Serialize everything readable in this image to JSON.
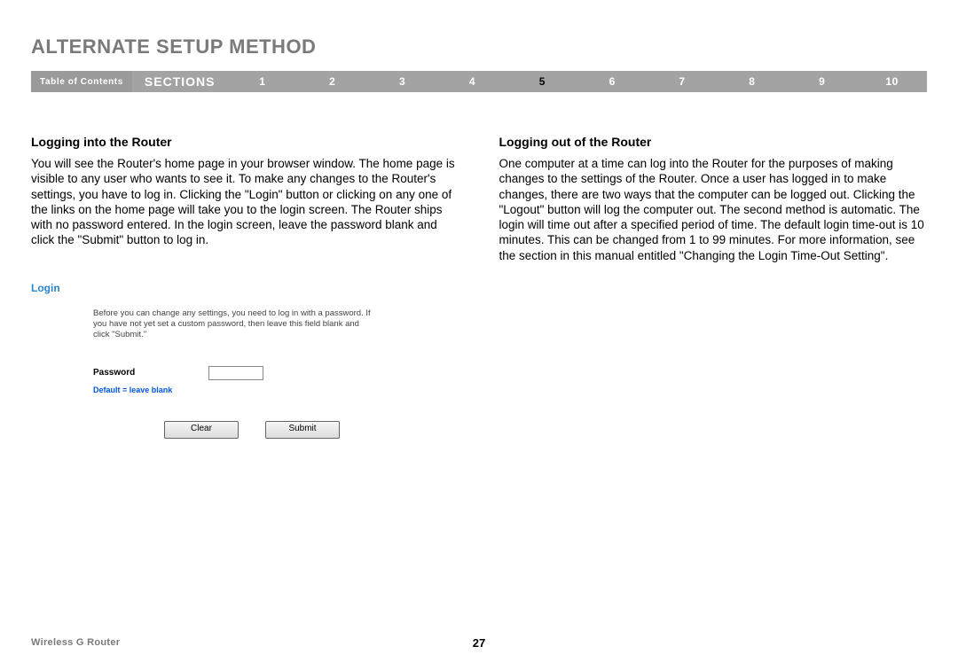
{
  "title": "ALTERNATE SETUP METHOD",
  "nav": {
    "toc": "Table of Contents",
    "sections_label": "SECTIONS",
    "items": [
      "1",
      "2",
      "3",
      "4",
      "5",
      "6",
      "7",
      "8",
      "9",
      "10"
    ],
    "active": "5"
  },
  "left": {
    "heading": "Logging into the Router",
    "body": "You will see the Router's home page in your browser window. The home page is visible to any user who wants to see it. To make any changes to the Router's settings, you have to log in. Clicking the \"Login\" button or clicking on any one of the links on the home page will take you to the login screen. The Router ships with no password entered. In the login screen, leave the password blank and click the \"Submit\" button to log in."
  },
  "right": {
    "heading": "Logging out of the Router",
    "body": "One computer at a time can log into the Router for the purposes of making changes to the settings of the Router. Once a user has logged in to make changes, there are two ways that the computer can be logged out. Clicking the \"Logout\" button will log the computer out. The second method is automatic. The login will time out after a specified period of time. The default login time-out is 10 minutes. This can be changed from 1 to 99 minutes. For more information, see the section in this manual entitled \"Changing the Login Time-Out Setting\"."
  },
  "login": {
    "title": "Login",
    "instructions": "Before you can change any settings, you need to log in with a password. If you have not yet set a custom password, then leave this field blank and click \"Submit.\"",
    "pw_label": "Password",
    "pw_hint": "Default = leave blank",
    "clear": "Clear",
    "submit": "Submit"
  },
  "footer": {
    "product": "Wireless G Router",
    "page": "27"
  }
}
